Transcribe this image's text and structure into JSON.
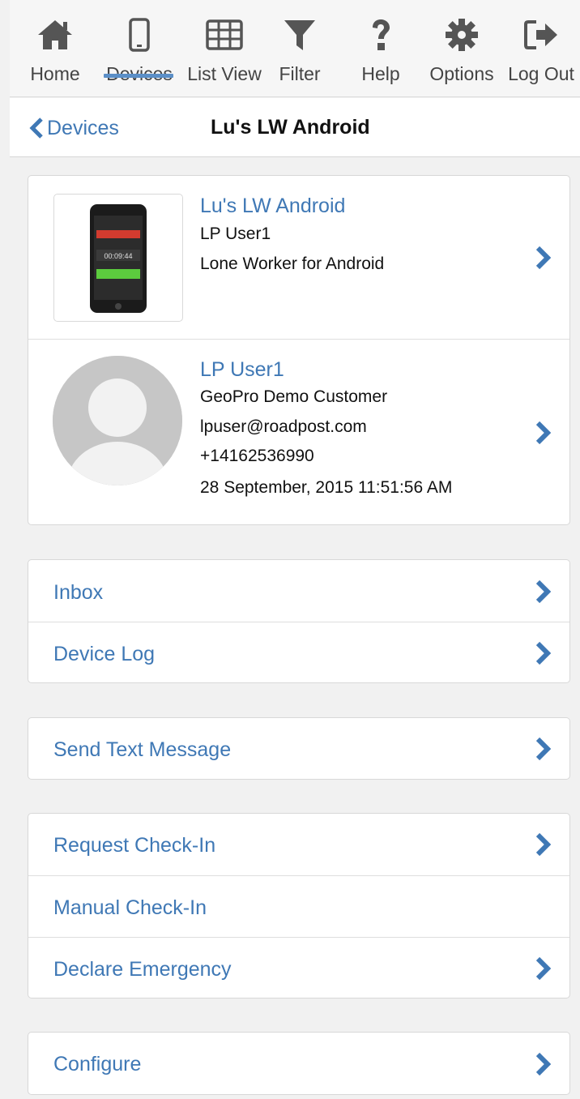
{
  "nav": {
    "items": [
      {
        "label": "Home",
        "icon": "home-icon"
      },
      {
        "label": "Devices",
        "icon": "mobile-icon",
        "active": true
      },
      {
        "label": "List View",
        "icon": "grid-icon"
      },
      {
        "label": "Filter",
        "icon": "filter-icon"
      },
      {
        "label": "Help",
        "icon": "question-icon"
      },
      {
        "label": "Options",
        "icon": "gear-icon"
      },
      {
        "label": "Log Out",
        "icon": "logout-icon"
      }
    ]
  },
  "titlebar": {
    "back_label": "Devices",
    "title": "Lu's LW Android"
  },
  "device_card": {
    "device": {
      "name": "Lu's LW Android",
      "user": "LP User1",
      "app": "Lone Worker for Android",
      "screen_timer": "00:09:44"
    },
    "user": {
      "name": "LP User1",
      "company": "GeoPro Demo Customer",
      "email": "lpuser@roadpost.com",
      "phone": "+14162536990",
      "timestamp": "28 September, 2015 11:51:56 AM"
    }
  },
  "menu": {
    "inbox": "Inbox",
    "device_log": "Device Log",
    "send_text": "Send Text Message",
    "request_checkin": "Request Check-In",
    "manual_checkin": "Manual Check-In",
    "declare_emergency": "Declare Emergency",
    "configure": "Configure"
  },
  "colors": {
    "accent": "#3f78b5",
    "active_underline": "#5b8fc7",
    "icon": "#555555"
  }
}
